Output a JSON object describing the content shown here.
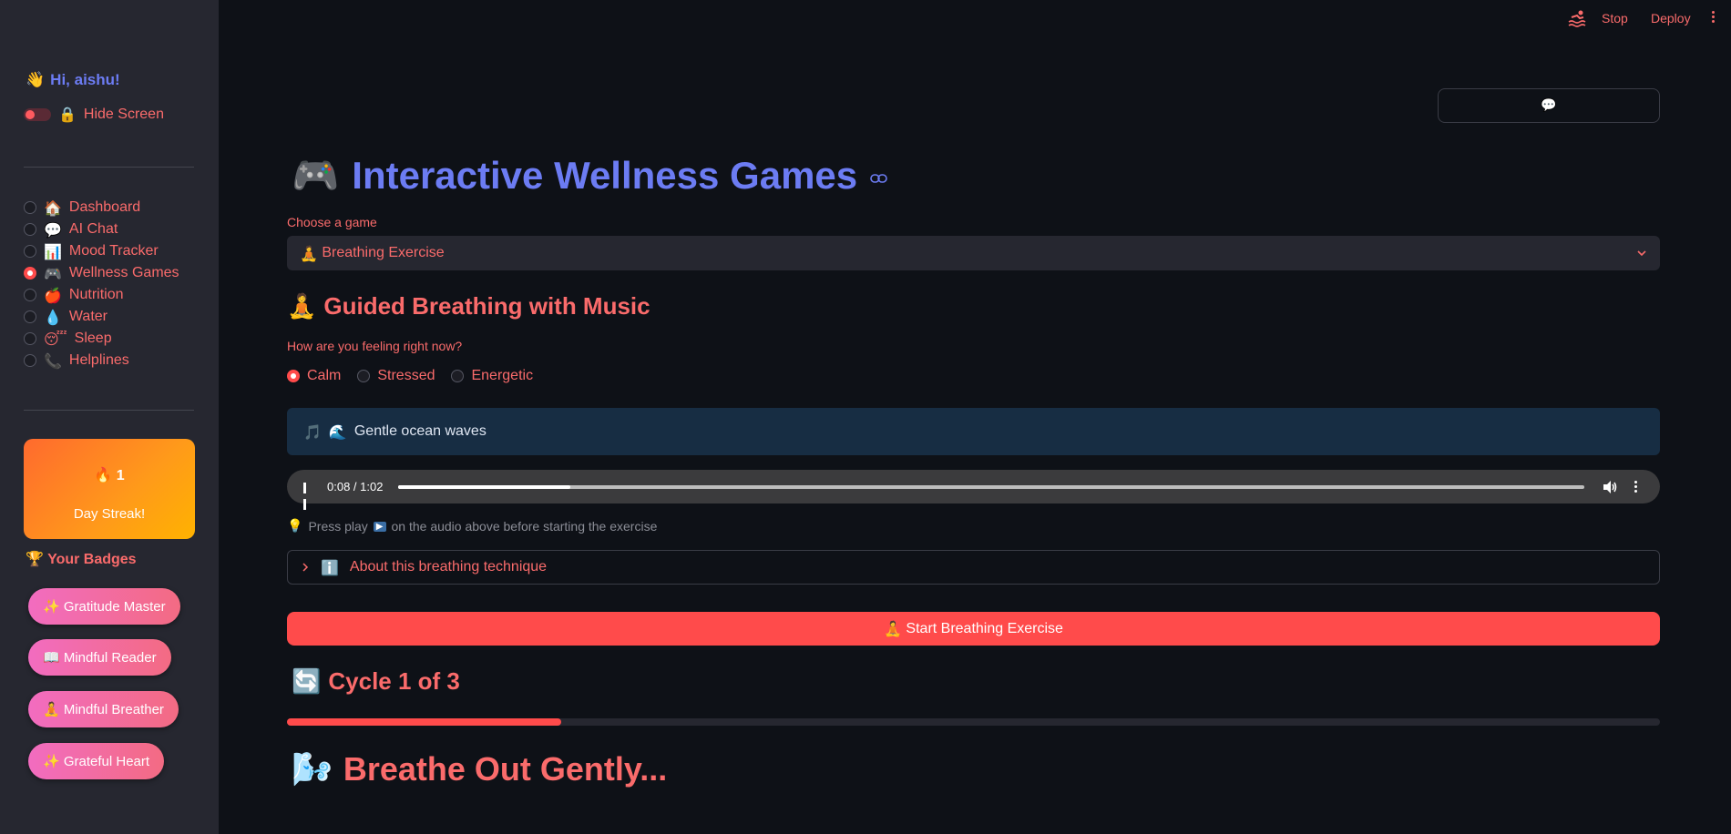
{
  "sidebar": {
    "greeting": "Hi, aishu!",
    "greeting_icon": "👋",
    "hide_screen_label": "Hide Screen",
    "hide_screen_icon": "🔒",
    "nav": [
      {
        "icon": "🏠",
        "label": "Dashboard",
        "selected": false
      },
      {
        "icon": "💬",
        "label": "AI Chat",
        "selected": false
      },
      {
        "icon": "📊",
        "label": "Mood Tracker",
        "selected": false
      },
      {
        "icon": "🎮",
        "label": "Wellness Games",
        "selected": true
      },
      {
        "icon": "🍎",
        "label": "Nutrition",
        "selected": false
      },
      {
        "icon": "💧",
        "label": "Water",
        "selected": false
      },
      {
        "icon": "😴",
        "label": "Sleep",
        "selected": false
      },
      {
        "icon": "📞",
        "label": "Helplines",
        "selected": false
      }
    ],
    "streak": {
      "icon": "🔥",
      "count": "1",
      "label": "Day Streak!"
    },
    "badges_title": "Your Badges",
    "badges_icon": "🏆",
    "badges": [
      {
        "icon": "✨",
        "label": "Gratitude Master"
      },
      {
        "icon": "📖",
        "label": "Mindful Reader"
      },
      {
        "icon": "🧘",
        "label": "Mindful Breather"
      },
      {
        "icon": "✨",
        "label": "Grateful Heart"
      }
    ]
  },
  "topbar": {
    "stop_label": "Stop",
    "deploy_label": "Deploy"
  },
  "chat_button_icon": "💬",
  "main": {
    "title_icon": "🎮",
    "title": "Interactive Wellness Games",
    "choose_label": "Choose a game",
    "selected_game_icon": "🧘",
    "selected_game": "Breathing Exercise",
    "section_icon": "🧘",
    "section_title": "Guided Breathing with Music",
    "feeling_question": "How are you feeling right now?",
    "moods": [
      {
        "label": "Calm",
        "selected": true
      },
      {
        "label": "Stressed",
        "selected": false
      },
      {
        "label": "Energetic",
        "selected": false
      }
    ],
    "music_icon": "🎵",
    "music_icon2": "🌊",
    "music_text": "Gentle ocean waves",
    "audio": {
      "time": "0:08 / 1:02",
      "progress": 0.145
    },
    "hint_icon": "💡",
    "hint_pre": "Press play",
    "hint_play_icon": "▶",
    "hint_post": "on the audio above before starting the exercise",
    "expander_icon": "ℹ️",
    "expander_label": "About this breathing technique",
    "start_icon": "🧘",
    "start_label": "Start Breathing Exercise",
    "cycle_icon": "🔄",
    "cycle_label": "Cycle 1 of 3",
    "cycle_progress": 0.2,
    "phase_icon": "🌬️",
    "phase_text": "Breathe Out Gently..."
  },
  "colors": {
    "accent": "#ff4b4b",
    "title": "#6c7cf3",
    "text": "#fa6b6b",
    "bg": "#0e1117",
    "sidebar": "#262730"
  }
}
